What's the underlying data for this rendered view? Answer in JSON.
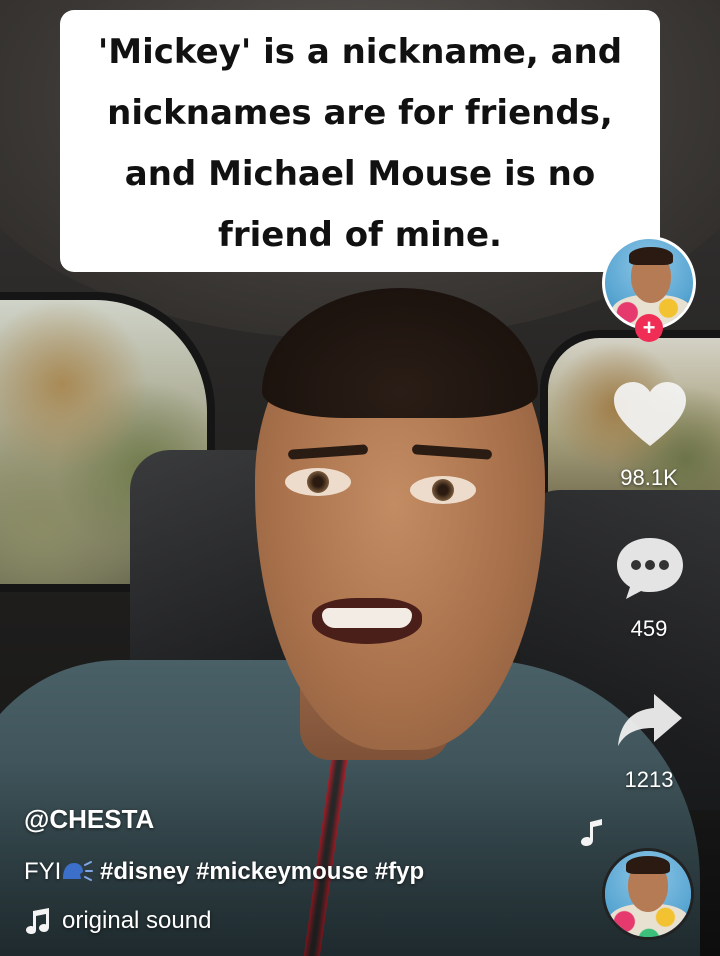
{
  "caption": {
    "lines": [
      "'Mickey' is a nickname, and",
      "nicknames are for friends,",
      "and Michael Mouse is no",
      "friend of mine."
    ]
  },
  "rail": {
    "follow_label": "+",
    "likes": "98.1K",
    "comments": "459",
    "shares": "1213",
    "icons": {
      "like": "heart-icon",
      "comment": "comment-bubble-icon",
      "share": "share-arrow-icon",
      "music": "music-note-icon"
    }
  },
  "post": {
    "username": "@CHESTA",
    "desc_prefix": "FYI",
    "hashtags": "#disney #mickeymouse #fyp",
    "sound": "original sound"
  },
  "colors": {
    "follow_badge": "#ef2d55",
    "caption_bg": "#ffffff",
    "caption_text": "#111111"
  }
}
